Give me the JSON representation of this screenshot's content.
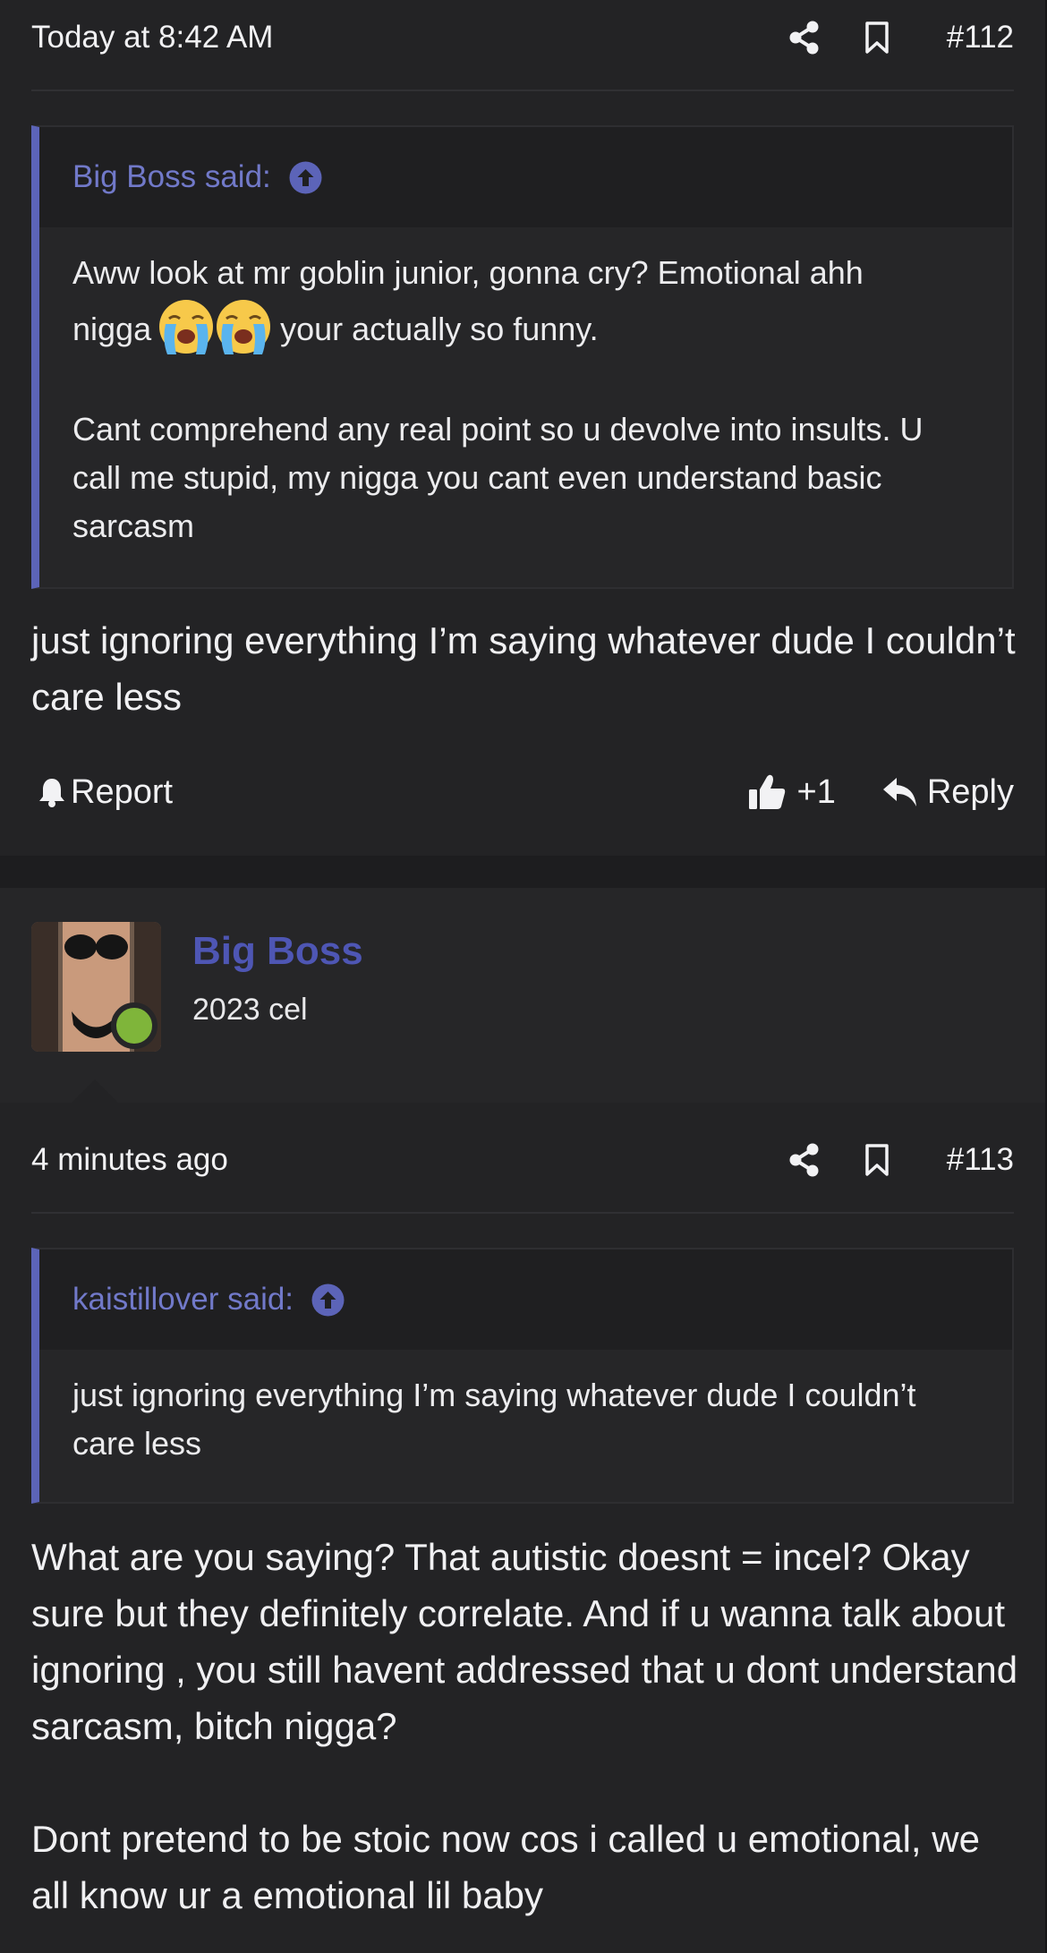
{
  "post_112": {
    "timestamp": "Today at 8:42 AM",
    "post_number": "#112",
    "quote": {
      "author_label": "Big Boss said:",
      "line1": "Aww look at mr goblin junior, gonna cry? Emotional ahh",
      "line2_before": "nigga",
      "line2_after": " your actually so funny.",
      "emoji": "loudly-crying-face",
      "para2": "Cant comprehend any real point so u devolve into insults. U call me stupid, my nigga you cant even understand basic sarcasm"
    },
    "body": "just ignoring everything I’m saying whatever dude I couldn’t care less",
    "actions": {
      "report_label": "Report",
      "reaction_count": "+1",
      "reply_label": "Reply"
    }
  },
  "post_113": {
    "user": {
      "name": "Big Boss",
      "title": "2023 cel",
      "online": true
    },
    "timestamp": "4 minutes ago",
    "post_number": "#113",
    "quote": {
      "author_label": "kaistillover said:",
      "text": "just ignoring everything I’m saying whatever dude I couldn’t care less"
    },
    "body_para1": "What are you saying? That autistic doesnt = incel? Okay sure but they definitely correlate. And if u wanna talk about ignoring , you still havent addressed that u dont understand sarcasm, bitch nigga?",
    "body_para2": "Dont pretend to be stoic now cos i called u emotional, we all know ur a emotional lil baby"
  },
  "colors": {
    "accent": "#5c64b8",
    "username": "#4e56b4",
    "quote_author": "#7179c9",
    "online": "#7fb53a",
    "background": "#232325"
  }
}
